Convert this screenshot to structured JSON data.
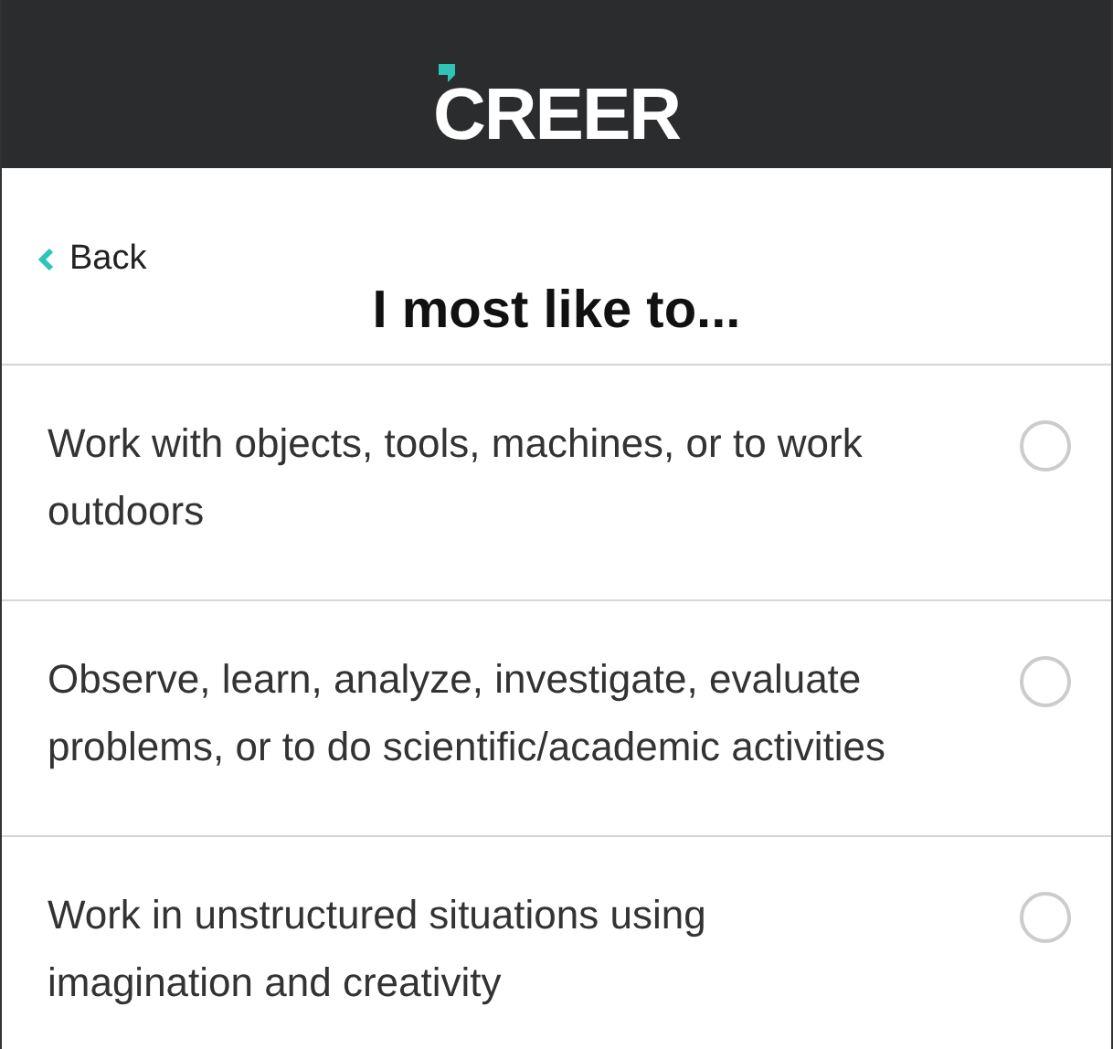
{
  "header": {
    "logo": "CREER"
  },
  "nav": {
    "back": "Back",
    "title": "I most like to..."
  },
  "options": [
    {
      "text": "Work with objects, tools, machines, or to work outdoors",
      "selected": false
    },
    {
      "text": "Observe, learn, analyze, investigate, evaluate problems, or to do scientific/academic activities",
      "selected": false
    },
    {
      "text": "Work in unstructured situations using imagination and creativity",
      "selected": false
    }
  ]
}
